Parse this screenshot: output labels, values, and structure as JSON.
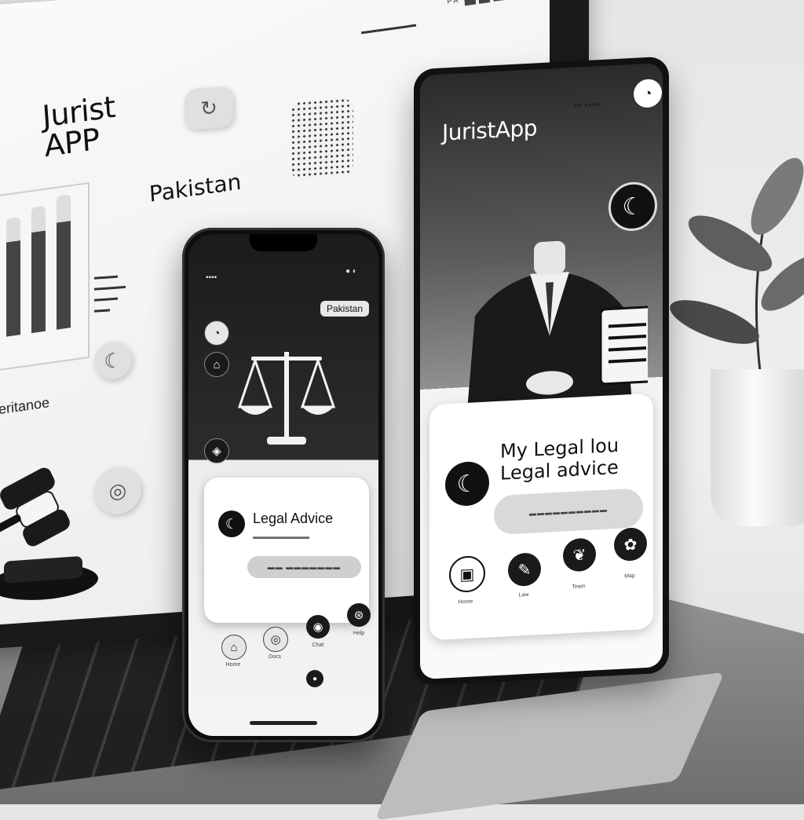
{
  "desktop": {
    "app_title_line1": "Jurist",
    "app_title_line2": "APP",
    "country": "Pakistan",
    "subtitle": "Gulberitanoe",
    "status_glyphs": "ᴾᴬ ⬛⬛⬛"
  },
  "phone": {
    "country_tag": "Pakistan",
    "card_title": "Legal Advice",
    "nav_items": [
      "Home",
      "Docs",
      "Chat",
      "Help"
    ]
  },
  "tablet": {
    "app_title": "JuristApp",
    "card_title_line1": "My Legal lou",
    "card_title_line2": "Legal advice",
    "nav_items": [
      "Home",
      "Law",
      "Team",
      "Map"
    ]
  },
  "colors": {
    "background": "#e6e6e6",
    "accent": "#111111",
    "card": "#ffffff"
  }
}
